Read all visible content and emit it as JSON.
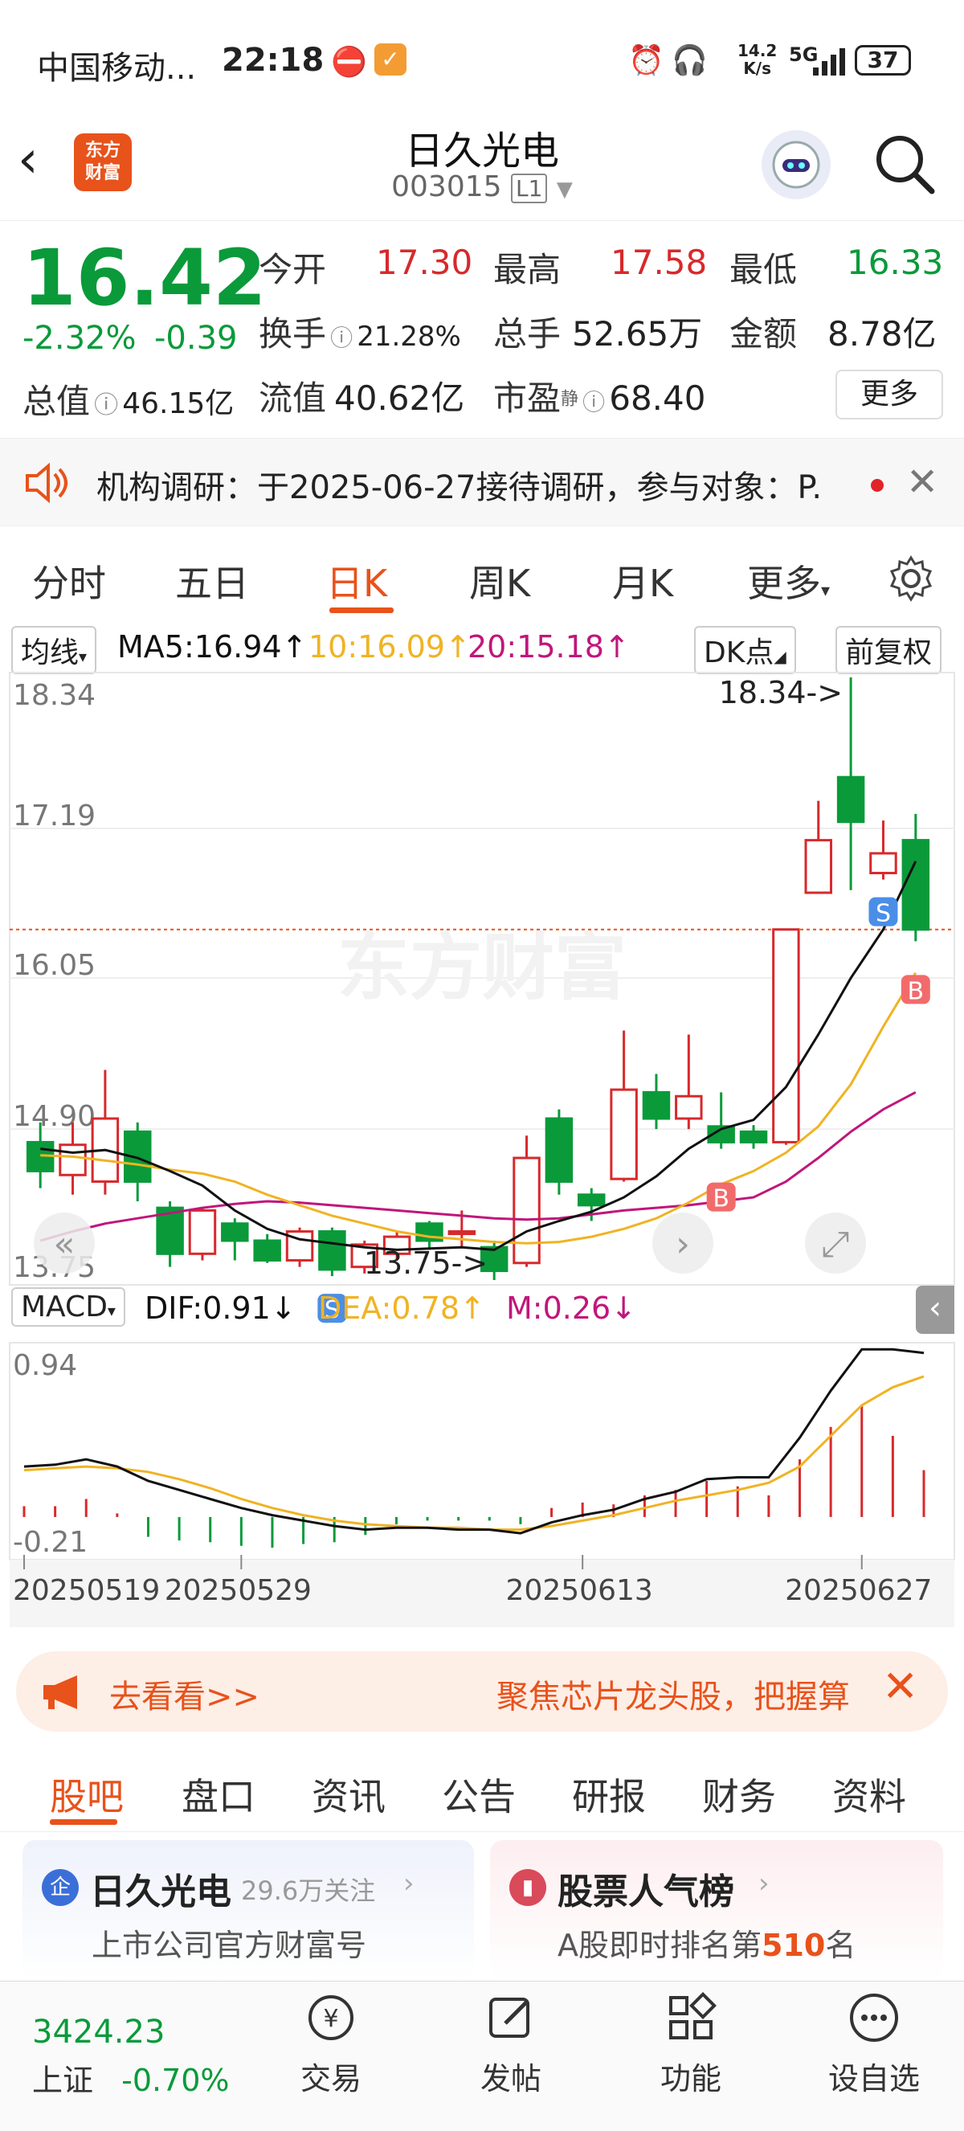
{
  "status_bar": {
    "carrier": "中国移动...",
    "time": "22:18",
    "network_speed_top": "14.2",
    "network_speed_bottom": "K/s",
    "signal": "5G",
    "battery": "37"
  },
  "header": {
    "back_label": "<",
    "logo_text_line1": "东方",
    "logo_text_line2": "财富",
    "title": "日久光电",
    "code": "003015",
    "level_badge": "L1"
  },
  "quote": {
    "price": "16.42",
    "change_pct": "-2.32%",
    "change_amt": "-0.39",
    "total_value_label": "总值",
    "total_value": "46.15亿",
    "open_label": "今开",
    "open": "17.30",
    "high_label": "最高",
    "high": "17.58",
    "low_label": "最低",
    "low": "16.33",
    "turnover_label": "换手",
    "turnover": "21.28%",
    "volume_label": "总手",
    "volume": "52.65万",
    "amount_label": "金额",
    "amount": "8.78亿",
    "float_label": "流值",
    "float_value": "40.62亿",
    "pe_label": "市盈",
    "pe_super": "静",
    "pe": "68.40",
    "more_label": "更多"
  },
  "notice": {
    "text": "机构调研：于2025-06-27接待调研，参与对象：P."
  },
  "period_tabs": {
    "items": [
      "分时",
      "五日",
      "日K",
      "周K",
      "月K",
      "更多"
    ],
    "active": "日K"
  },
  "ma_row": {
    "ma_select": "均线",
    "ma5": "MA5:16.94↑",
    "ma10": "10:16.09↑",
    "ma20": "20:15.18↑",
    "dk_label": "DK点",
    "fq_label": "前复权"
  },
  "macd_row": {
    "select": "MACD",
    "dif": "DIF:0.91↓",
    "dea": "DEA:0.78↑",
    "m": "M:0.26↓"
  },
  "colors": {
    "up": "#d7292c",
    "down": "#0a9a3a",
    "accent": "#e8521b",
    "ma5": "#111111",
    "ma10": "#f0b323",
    "ma20": "#c0167b"
  },
  "chart_data": [
    {
      "type": "candlestick",
      "title": "",
      "price_axis_labels": [
        "18.34",
        "17.19",
        "16.05",
        "14.90",
        "13.75"
      ],
      "ylim": [
        13.75,
        18.34
      ],
      "max_marker": "18.34->",
      "min_marker": "13.75->",
      "signal_markers": [
        {
          "label": "S",
          "index": 9
        },
        {
          "label": "B",
          "index": 21
        },
        {
          "label": "S",
          "index": 26
        },
        {
          "label": "B",
          "index": 28
        }
      ],
      "candles": [
        {
          "o": 14.8,
          "c": 14.58,
          "h": 14.95,
          "l": 14.45
        },
        {
          "o": 14.55,
          "c": 14.78,
          "h": 14.95,
          "l": 14.4
        },
        {
          "o": 14.5,
          "c": 14.98,
          "h": 15.35,
          "l": 14.4
        },
        {
          "o": 14.88,
          "c": 14.5,
          "h": 14.95,
          "l": 14.35
        },
        {
          "o": 14.3,
          "c": 13.95,
          "h": 14.35,
          "l": 13.85
        },
        {
          "o": 13.95,
          "c": 14.28,
          "h": 14.3,
          "l": 13.9
        },
        {
          "o": 14.18,
          "c": 14.05,
          "h": 14.22,
          "l": 13.9
        },
        {
          "o": 14.05,
          "c": 13.9,
          "h": 14.1,
          "l": 13.88
        },
        {
          "o": 13.9,
          "c": 14.12,
          "h": 14.15,
          "l": 13.85
        },
        {
          "o": 14.12,
          "c": 13.83,
          "h": 14.15,
          "l": 13.78
        },
        {
          "o": 13.85,
          "c": 14.02,
          "h": 14.05,
          "l": 13.8
        },
        {
          "o": 13.95,
          "c": 14.08,
          "h": 14.12,
          "l": 13.9
        },
        {
          "o": 14.18,
          "c": 14.05,
          "h": 14.2,
          "l": 13.98
        },
        {
          "o": 14.12,
          "c": 14.12,
          "h": 14.28,
          "l": 14.0
        },
        {
          "o": 14.0,
          "c": 13.82,
          "h": 14.05,
          "l": 13.75
        },
        {
          "o": 13.88,
          "c": 14.68,
          "h": 14.85,
          "l": 13.85
        },
        {
          "o": 14.98,
          "c": 14.5,
          "h": 15.05,
          "l": 14.4
        },
        {
          "o": 14.4,
          "c": 14.32,
          "h": 14.45,
          "l": 14.2
        },
        {
          "o": 14.52,
          "c": 15.2,
          "h": 15.65,
          "l": 14.5
        },
        {
          "o": 15.18,
          "c": 14.98,
          "h": 15.32,
          "l": 14.9
        },
        {
          "o": 14.98,
          "c": 15.15,
          "h": 15.62,
          "l": 14.9
        },
        {
          "o": 14.92,
          "c": 14.8,
          "h": 15.18,
          "l": 14.75
        },
        {
          "o": 14.88,
          "c": 14.8,
          "h": 14.93,
          "l": 14.75
        },
        {
          "o": 14.8,
          "c": 16.42,
          "h": 16.42,
          "l": 14.78
        },
        {
          "o": 16.7,
          "c": 17.1,
          "h": 17.4,
          "l": 16.7
        },
        {
          "o": 17.58,
          "c": 17.24,
          "h": 18.34,
          "l": 16.72
        },
        {
          "o": 16.85,
          "c": 17.0,
          "h": 17.25,
          "l": 16.8
        },
        {
          "o": 17.1,
          "c": 16.42,
          "h": 17.3,
          "l": 16.33
        }
      ],
      "ma5": [
        14.75,
        14.72,
        14.74,
        14.68,
        14.58,
        14.47,
        14.28,
        14.14,
        14.06,
        14.03,
        14.0,
        13.98,
        13.99,
        14.0,
        13.98,
        14.12,
        14.2,
        14.27,
        14.38,
        14.54,
        14.75,
        14.9,
        14.97,
        15.22,
        15.62,
        16.05,
        16.42,
        16.94
      ],
      "ma10": [
        14.7,
        14.69,
        14.66,
        14.63,
        14.59,
        14.56,
        14.5,
        14.4,
        14.32,
        14.24,
        14.18,
        14.12,
        14.08,
        14.06,
        14.04,
        14.03,
        14.04,
        14.08,
        14.14,
        14.22,
        14.34,
        14.48,
        14.58,
        14.72,
        14.92,
        15.24,
        15.68,
        16.09
      ],
      "ma20": [
        14.05,
        14.12,
        14.18,
        14.22,
        14.26,
        14.3,
        14.33,
        14.35,
        14.34,
        14.32,
        14.3,
        14.28,
        14.26,
        14.24,
        14.22,
        14.21,
        14.22,
        14.25,
        14.28,
        14.3,
        14.32,
        14.35,
        14.38,
        14.5,
        14.68,
        14.88,
        15.05,
        15.18
      ]
    },
    {
      "type": "macd",
      "axis_labels": [
        "0.94",
        "-0.21"
      ],
      "ylim": [
        -0.21,
        0.94
      ],
      "x_labels": [
        "20250519",
        "20250529",
        "20250613",
        "20250627"
      ],
      "dif": [
        0.28,
        0.29,
        0.32,
        0.28,
        0.2,
        0.15,
        0.1,
        0.05,
        0.01,
        -0.02,
        -0.05,
        -0.07,
        -0.06,
        -0.06,
        -0.07,
        -0.07,
        -0.09,
        -0.03,
        0.01,
        0.04,
        0.1,
        0.14,
        0.21,
        0.22,
        0.22,
        0.44,
        0.7,
        0.93,
        0.93,
        0.91
      ],
      "dea": [
        0.26,
        0.27,
        0.28,
        0.27,
        0.25,
        0.21,
        0.16,
        0.1,
        0.05,
        0.01,
        -0.02,
        -0.04,
        -0.05,
        -0.06,
        -0.06,
        -0.07,
        -0.07,
        -0.05,
        -0.02,
        0.01,
        0.05,
        0.09,
        0.12,
        0.15,
        0.19,
        0.28,
        0.45,
        0.62,
        0.72,
        0.78
      ],
      "m": [
        0.06,
        0.06,
        0.1,
        0.02,
        -0.11,
        -0.13,
        -0.14,
        -0.16,
        -0.17,
        -0.15,
        -0.14,
        -0.1,
        -0.04,
        -0.02,
        -0.02,
        -0.02,
        -0.04,
        0.05,
        0.08,
        0.07,
        0.12,
        0.15,
        0.2,
        0.17,
        0.12,
        0.32,
        0.5,
        0.62,
        0.45,
        0.26
      ]
    }
  ],
  "banner": {
    "cta": "去看看>>",
    "text": "聚焦芯片龙头股，把握算"
  },
  "section_tabs": {
    "items": [
      "股吧",
      "盘口",
      "资讯",
      "公告",
      "研报",
      "财务",
      "资料"
    ],
    "active": "股吧"
  },
  "cards": {
    "left_badge": "企",
    "left_title": "日久光电",
    "left_followers": "29.6万关注",
    "left_sub": "上市公司官方财富号",
    "right_title": "股票人气榜",
    "right_sub_prefix": "A股即时排名第",
    "right_rank": "510",
    "right_sub_suffix": "名"
  },
  "bottom_nav": {
    "index_value": "3424.23",
    "index_name": "上证",
    "index_change": "-0.70%",
    "items": [
      "交易",
      "发帖",
      "功能",
      "设自选"
    ]
  }
}
